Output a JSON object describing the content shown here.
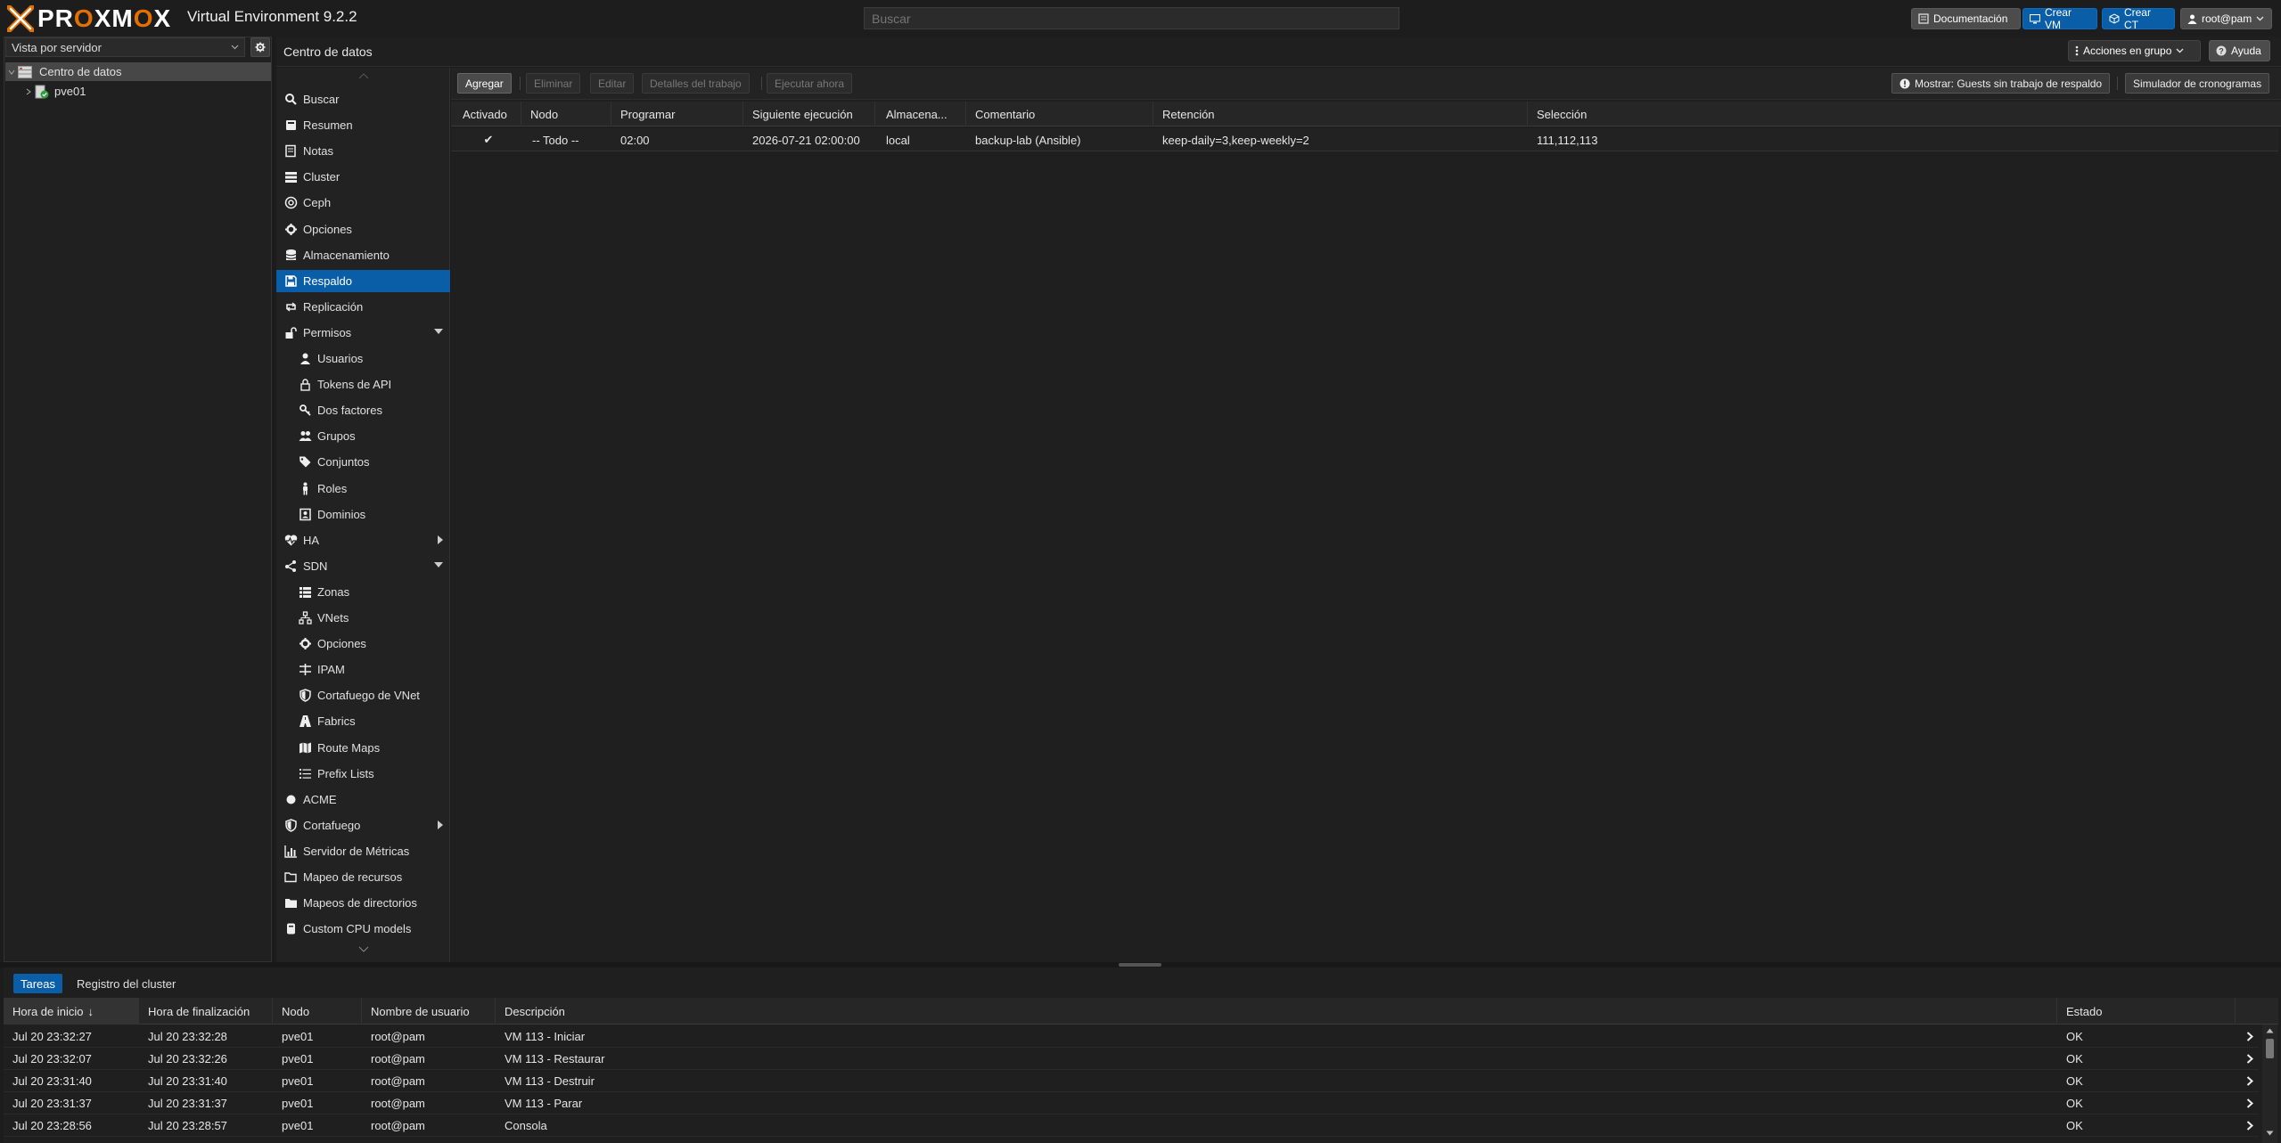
{
  "header": {
    "logo_text": "PROXMOX",
    "product": "Virtual Environment 9.2.2",
    "search_placeholder": "Buscar",
    "doc_label": "Documentación",
    "create_vm_label": "Crear VM",
    "create_ct_label": "Crear CT",
    "user_label": "root@pam"
  },
  "tree": {
    "view_label": "Vista por servidor",
    "datacenter_label": "Centro de datos",
    "node_label": "pve01"
  },
  "content": {
    "title": "Centro de datos",
    "bulk_actions_label": "Acciones en grupo",
    "help_label": "Ayuda"
  },
  "nav": {
    "items": [
      {
        "label": "Buscar",
        "icon": "search-icon"
      },
      {
        "label": "Resumen",
        "icon": "book-icon"
      },
      {
        "label": "Notas",
        "icon": "notes-icon"
      },
      {
        "label": "Cluster",
        "icon": "server-icon"
      },
      {
        "label": "Ceph",
        "icon": "ceph-icon"
      },
      {
        "label": "Opciones",
        "icon": "gear-icon"
      },
      {
        "label": "Almacenamiento",
        "icon": "database-icon"
      },
      {
        "label": "Respaldo",
        "icon": "floppy-icon"
      },
      {
        "label": "Replicación",
        "icon": "retweet-icon"
      },
      {
        "label": "Permisos",
        "icon": "unlock-icon"
      },
      {
        "label": "Usuarios",
        "icon": "user-icon"
      },
      {
        "label": "Tokens de API",
        "icon": "lock-icon"
      },
      {
        "label": "Dos factores",
        "icon": "key-icon"
      },
      {
        "label": "Grupos",
        "icon": "users-icon"
      },
      {
        "label": "Conjuntos",
        "icon": "tags-icon"
      },
      {
        "label": "Roles",
        "icon": "male-icon"
      },
      {
        "label": "Dominios",
        "icon": "address-book-icon"
      },
      {
        "label": "HA",
        "icon": "heartbeat-icon"
      },
      {
        "label": "SDN",
        "icon": "sdn-icon"
      },
      {
        "label": "Zonas",
        "icon": "th-list-icon"
      },
      {
        "label": "VNets",
        "icon": "network-icon"
      },
      {
        "label": "Opciones",
        "icon": "gear-icon"
      },
      {
        "label": "IPAM",
        "icon": "ipam-icon"
      },
      {
        "label": "Cortafuego de VNet",
        "icon": "shield-icon"
      },
      {
        "label": "Fabrics",
        "icon": "road-icon"
      },
      {
        "label": "Route Maps",
        "icon": "map-icon"
      },
      {
        "label": "Prefix Lists",
        "icon": "list-icon"
      },
      {
        "label": "ACME",
        "icon": "acme-icon"
      },
      {
        "label": "Cortafuego",
        "icon": "shield-icon"
      },
      {
        "label": "Servidor de Métricas",
        "icon": "bar-chart-icon"
      },
      {
        "label": "Mapeo de recursos",
        "icon": "folder-open-icon"
      },
      {
        "label": "Mapeos de directorios",
        "icon": "folder-icon"
      },
      {
        "label": "Custom CPU models",
        "icon": "cpu-icon"
      }
    ]
  },
  "backup": {
    "toolbar": {
      "add": "Agregar",
      "remove": "Eliminar",
      "edit": "Editar",
      "job_details": "Detalles del trabajo",
      "run_now": "Ejecutar ahora",
      "show_guests": "Mostrar: Guests sin trabajo de respaldo",
      "schedule_sim": "Simulador de cronogramas"
    },
    "columns": [
      "Activado",
      "Nodo",
      "Programar",
      "Siguiente ejecución",
      "Almacena...",
      "Comentario",
      "Retención",
      "Selección"
    ],
    "rows": [
      {
        "enabled": "✔",
        "node": "-- Todo --",
        "schedule": "02:00",
        "next_run": "2026-07-21 02:00:00",
        "storage": "local",
        "comment": "backup-lab (Ansible)",
        "retention": "keep-daily=3,keep-weekly=2",
        "selection": "111,112,113"
      }
    ]
  },
  "bottom": {
    "tabs": [
      "Tareas",
      "Registro del cluster"
    ],
    "columns": [
      "Hora de inicio",
      "Hora de finalización",
      "Nodo",
      "Nombre de usuario",
      "Descripción",
      "Estado"
    ],
    "sort_indicator": "↓",
    "tasks": [
      {
        "start": "Jul 20 23:32:27",
        "end": "Jul 20 23:32:28",
        "node": "pve01",
        "user": "root@pam",
        "desc": "VM 113 - Iniciar",
        "status": "OK"
      },
      {
        "start": "Jul 20 23:32:07",
        "end": "Jul 20 23:32:26",
        "node": "pve01",
        "user": "root@pam",
        "desc": "VM 113 - Restaurar",
        "status": "OK"
      },
      {
        "start": "Jul 20 23:31:40",
        "end": "Jul 20 23:31:40",
        "node": "pve01",
        "user": "root@pam",
        "desc": "VM 113 - Destruir",
        "status": "OK"
      },
      {
        "start": "Jul 20 23:31:37",
        "end": "Jul 20 23:31:37",
        "node": "pve01",
        "user": "root@pam",
        "desc": "VM 113 - Parar",
        "status": "OK"
      },
      {
        "start": "Jul 20 23:28:56",
        "end": "Jul 20 23:28:57",
        "node": "pve01",
        "user": "root@pam",
        "desc": "Consola",
        "status": "OK"
      }
    ]
  },
  "colors": {
    "accent": "#0a5ea8",
    "brand_orange": "#e57000",
    "background": "#1c1c1c"
  }
}
